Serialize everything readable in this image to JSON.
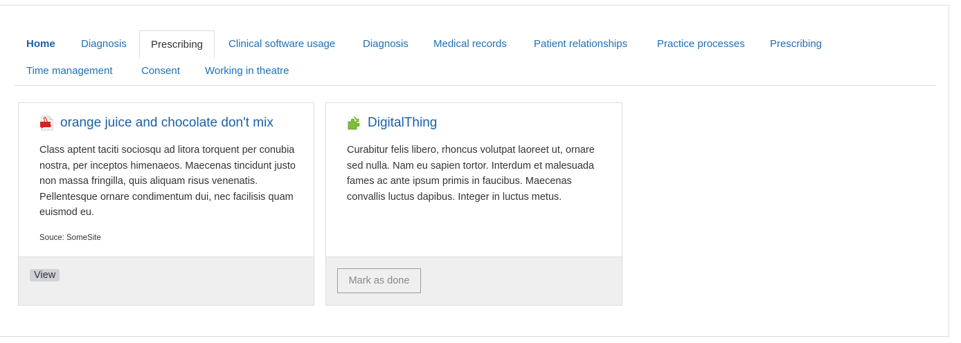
{
  "tabs": [
    {
      "label": "Home",
      "bold": true,
      "active": false
    },
    {
      "label": "Diagnosis",
      "active": false
    },
    {
      "label": "Prescribing",
      "active": true
    },
    {
      "label": "Clinical software usage",
      "active": false
    },
    {
      "label": "Diagnosis",
      "active": false
    },
    {
      "label": "Medical records",
      "active": false
    },
    {
      "label": "Patient relationships",
      "active": false
    },
    {
      "label": "Practice processes",
      "active": false
    },
    {
      "label": "Prescribing",
      "active": false
    },
    {
      "label": "Time management",
      "active": false
    },
    {
      "label": "Consent",
      "active": false
    },
    {
      "label": "Working in theatre",
      "active": false
    }
  ],
  "cards": [
    {
      "icon": "pdf-icon",
      "title": "orange juice and chocolate don't mix",
      "description": "Class aptent taciti sociosqu ad litora torquent per conubia nostra, per inceptos himenaeos. Maecenas tincidunt justo non massa fringilla, quis aliquam risus venenatis. Pellentesque ornare condimentum dui, nec facilisis quam euismod eu.",
      "source": "Souce: SomeSite",
      "action_label": "View"
    },
    {
      "icon": "puzzle-piece-icon",
      "title": "DigitalThing",
      "description": "Curabitur felis libero, rhoncus volutpat laoreet ut, ornare sed nulla. Nam eu sapien tortor. Interdum et malesuada fames ac ante ipsum primis in faucibus. Maecenas convallis luctus dapibus. Integer in luctus metus.",
      "action_label": "Mark as done"
    }
  ],
  "colors": {
    "link": "#1a5fa8",
    "footer_bg": "#efefef",
    "border": "#dcdcdc",
    "pdf_icon": "#d9211e",
    "puzzle_icon": "#7bbf3a"
  }
}
